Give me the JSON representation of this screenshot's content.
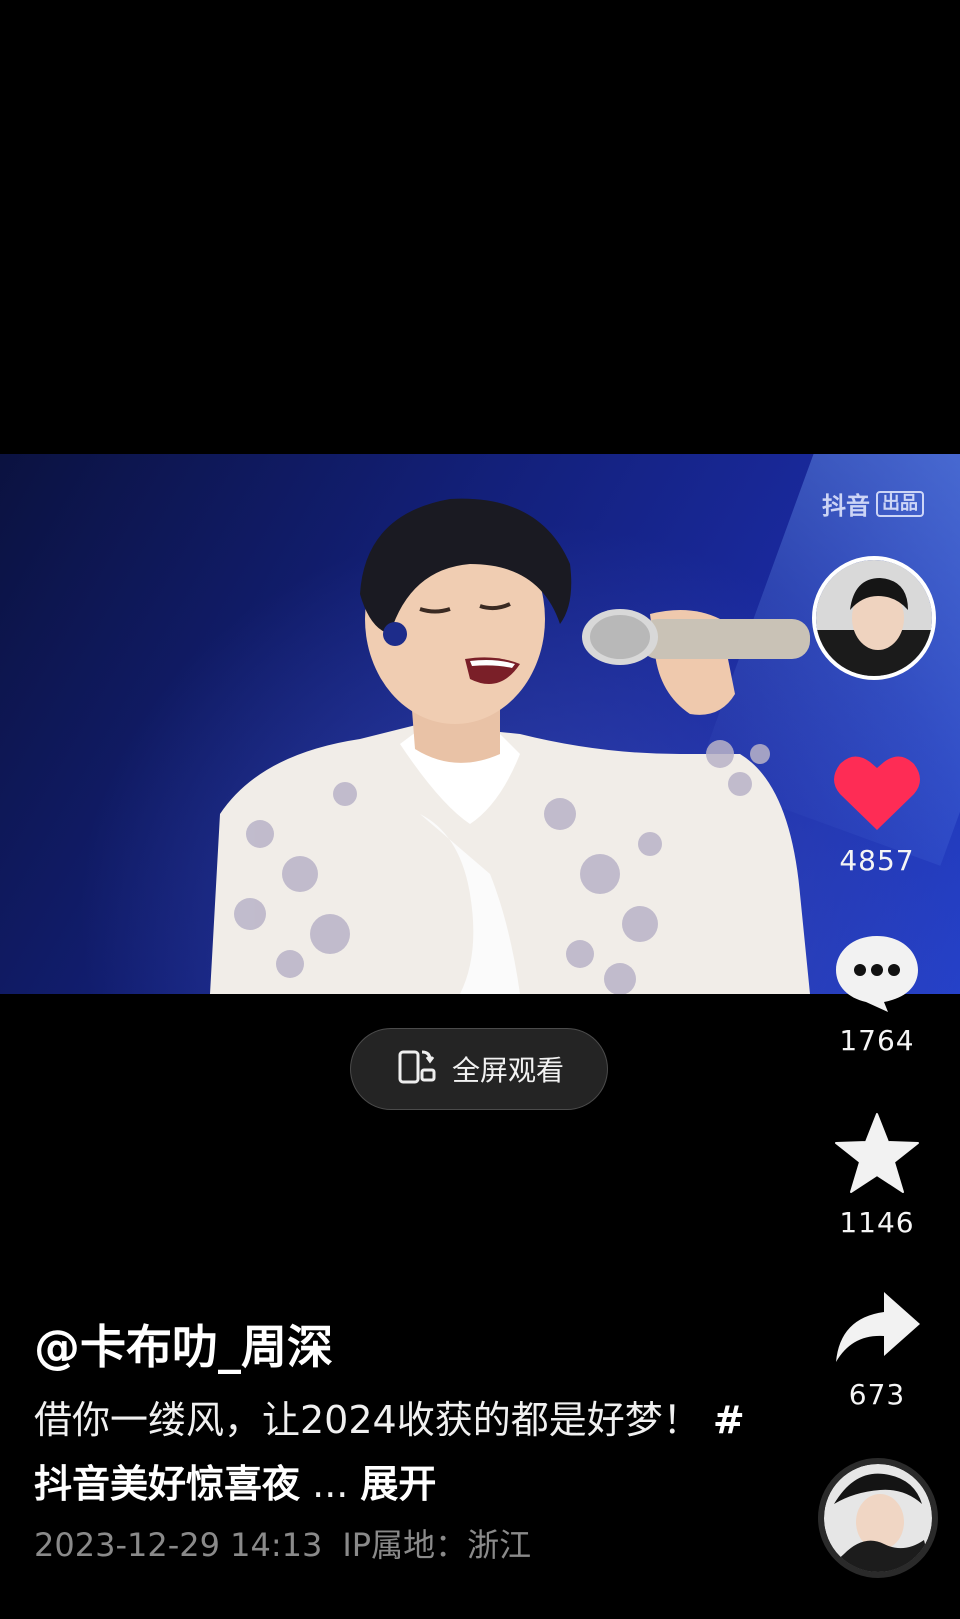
{
  "video": {
    "watermark_text": "抖音",
    "watermark_tag": "出品"
  },
  "fullscreen": {
    "label": "全屏观看",
    "icon": "rotate-screen-icon"
  },
  "actions": {
    "like_count": "4857",
    "comment_count": "1764",
    "favorite_count": "1146",
    "share_count": "673",
    "like_color": "#fe2c55"
  },
  "author": {
    "username": "@卡布叻_周深"
  },
  "caption": {
    "text": "借你一缕风，让2024收获的都是好梦！",
    "hashtag": "#抖音美好惊喜夜",
    "ellipsis": "...",
    "expand_label": "展开"
  },
  "meta": {
    "datetime": "2023-12-29 14:13",
    "ip_location": "IP属地：浙江"
  }
}
